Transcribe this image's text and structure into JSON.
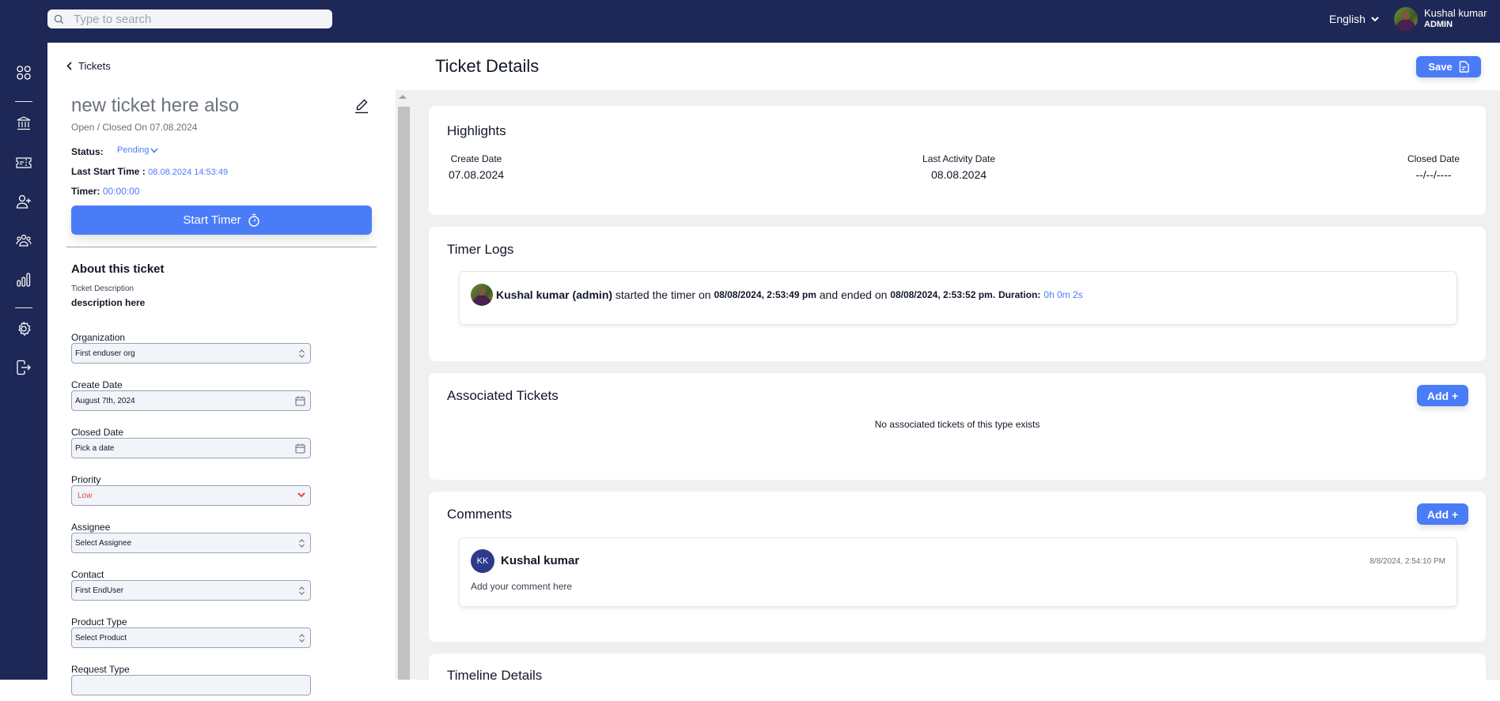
{
  "topbar": {
    "search_placeholder": "Type to search",
    "language": "English",
    "user_name": "Kushal kumar",
    "user_role": "ADMIN"
  },
  "rail": {
    "items": [
      "dashboard-icon",
      "organization-icon",
      "tickets-icon",
      "add-user-icon",
      "team-icon",
      "reports-icon",
      "settings-icon",
      "logout-icon"
    ]
  },
  "side": {
    "back_label": "Tickets",
    "ticket_title": "new ticket here also",
    "ticket_subtitle": "Open / Closed On 07.08.2024",
    "status_label": "Status:",
    "status_value": "Pending",
    "last_start_label": "Last Start Time :",
    "last_start_value": "08.08.2024 14:53:49",
    "timer_label": "Timer:",
    "timer_value": "00:00:00",
    "start_timer_label": "Start Timer",
    "about_heading": "About this ticket",
    "description_label": "Ticket Description",
    "description_value": "description here",
    "fields": {
      "organization": {
        "label": "Organization",
        "value": "First enduser org"
      },
      "create_date": {
        "label": "Create Date",
        "value": "August 7th, 2024"
      },
      "closed_date": {
        "label": "Closed Date",
        "value": "Pick a date"
      },
      "priority": {
        "label": "Priority",
        "value": "Low"
      },
      "assignee": {
        "label": "Assignee",
        "value": "Select Assignee"
      },
      "contact": {
        "label": "Contact",
        "value": "First EndUser"
      },
      "product_type": {
        "label": "Product Type",
        "value": "Select Product"
      },
      "request_type": {
        "label": "Request Type",
        "value": ""
      }
    }
  },
  "main": {
    "page_title": "Ticket Details",
    "save_label": "Save",
    "highlights": {
      "title": "Highlights",
      "create_date_label": "Create Date",
      "create_date_value": "07.08.2024",
      "last_activity_label": "Last Activity Date",
      "last_activity_value": "08.08.2024",
      "closed_date_label": "Closed Date",
      "closed_date_value": "--/--/----"
    },
    "timer_logs": {
      "title": "Timer Logs",
      "entries": [
        {
          "user": "Kushal kumar (admin)",
          "started_text": "started the timer on",
          "start": "08/08/2024, 2:53:49 pm",
          "ended_text": "and ended on",
          "end": "08/08/2024, 2:53:52 pm.",
          "duration_label": "Duration:",
          "duration": "0h 0m 2s"
        }
      ]
    },
    "associated": {
      "title": "Associated Tickets",
      "add_label": "Add +",
      "empty_message": "No associated tickets of this type exists"
    },
    "comments": {
      "title": "Comments",
      "add_label": "Add +",
      "items": [
        {
          "initials": "KK",
          "author": "Kushal kumar",
          "timestamp": "8/8/2024, 2:54:10 PM",
          "body": "Add your comment here"
        }
      ]
    },
    "timeline": {
      "title": "Timeline Details"
    }
  },
  "colors": {
    "navy": "#1d2856",
    "accent": "#4a7cf7",
    "link_blue": "#4f7cf7",
    "priority_low": "#ef4444",
    "background": "#f0f0f0"
  }
}
